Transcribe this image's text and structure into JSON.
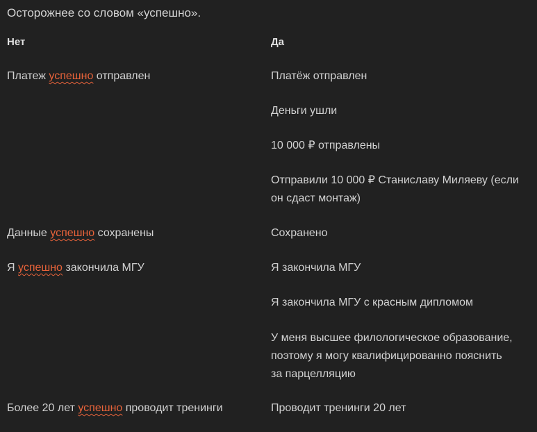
{
  "intro": "Осторожнее со словом «успешно».",
  "headers": {
    "no": "Нет",
    "yes": "Да"
  },
  "no_rows": [
    {
      "pre": "Платеж ",
      "word": "успешно",
      "post": " отправлен"
    },
    {
      "pre": "Данные ",
      "word": "успешно",
      "post": " сохранены"
    },
    {
      "pre": "Я ",
      "word": "успешно",
      "post": " закончила МГУ"
    },
    {
      "pre": "Более 20 лет ",
      "word": "успешно",
      "post": " проводит тренинги"
    }
  ],
  "yes_rows": [
    "Платёж отправлен",
    "Деньги ушли",
    "10 000 ₽ отправлены",
    "Отправили 10 000 ₽ Станиславу Миляеву (если он сдаст монтаж)",
    "Сохранено",
    "Я закончила МГУ",
    "Я закончила МГУ с красным дипломом",
    "У меня высшее филологическое образование, поэтому я могу квалифицированно пояснить за парцелляцию",
    "Проводит тренинги 20 лет"
  ],
  "colors": {
    "background": "#212121",
    "text": "#d2d2d2",
    "highlight": "#e8633a"
  }
}
